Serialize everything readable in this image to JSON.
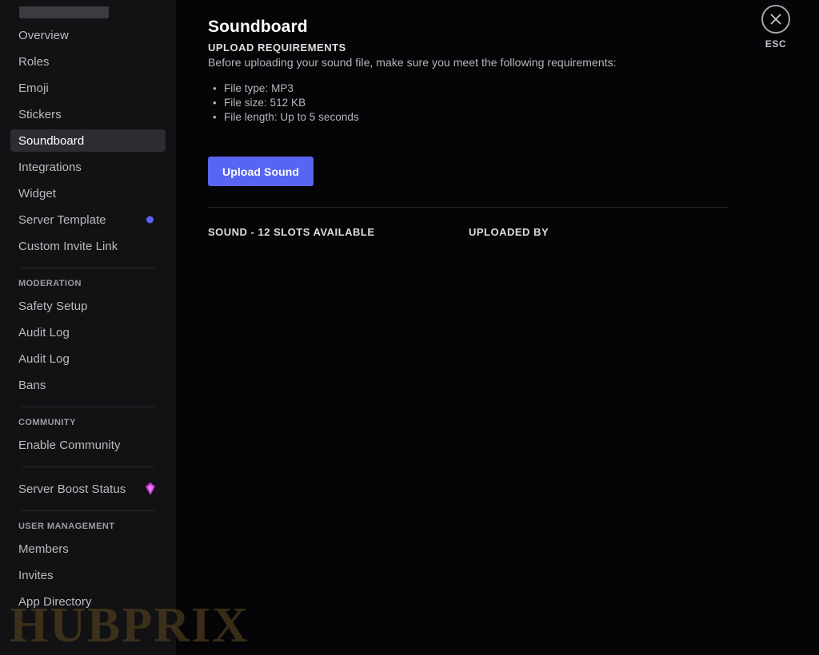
{
  "window": {
    "background_color": "#050507",
    "sidebar_color": "#121214",
    "accent_color": "#5865f2",
    "boost_color": "#ff73fa"
  },
  "sidebar": {
    "skeleton_placeholder": "",
    "groups": [
      {
        "header": null,
        "items": [
          {
            "label": "Overview",
            "selected": false,
            "badge": null
          },
          {
            "label": "Roles",
            "selected": false,
            "badge": null
          },
          {
            "label": "Emoji",
            "selected": false,
            "badge": null
          },
          {
            "label": "Stickers",
            "selected": false,
            "badge": null
          },
          {
            "label": "Soundboard",
            "selected": true,
            "badge": null
          },
          {
            "label": "Integrations",
            "selected": false,
            "badge": null
          },
          {
            "label": "Widget",
            "selected": false,
            "badge": null
          },
          {
            "label": "Server Template",
            "selected": false,
            "badge": "dot"
          },
          {
            "label": "Custom Invite Link",
            "selected": false,
            "badge": null
          }
        ]
      },
      {
        "header": "MODERATION",
        "items": [
          {
            "label": "Safety Setup",
            "selected": false,
            "badge": null
          },
          {
            "label": "Audit Log",
            "selected": false,
            "badge": null
          },
          {
            "label": "Audit Log",
            "selected": false,
            "badge": null
          },
          {
            "label": "Bans",
            "selected": false,
            "badge": null
          }
        ]
      },
      {
        "header": "COMMUNITY",
        "items": [
          {
            "label": "Enable Community",
            "selected": false,
            "badge": null
          }
        ]
      },
      {
        "header": null,
        "items": [
          {
            "label": "Server Boost Status",
            "selected": false,
            "badge": "boost"
          }
        ]
      },
      {
        "header": "USER MANAGEMENT",
        "items": [
          {
            "label": "Members",
            "selected": false,
            "badge": null
          },
          {
            "label": "Invites",
            "selected": false,
            "badge": null
          },
          {
            "label": "App Directory",
            "selected": false,
            "badge": null
          }
        ]
      }
    ]
  },
  "main": {
    "title": "Soundboard",
    "requirements_heading": "UPLOAD REQUIREMENTS",
    "requirements_description": "Before uploading your sound file, make sure you meet the following requirements:",
    "requirements": [
      "File type: MP3",
      "File size: 512 KB",
      "File length: Up to 5 seconds"
    ],
    "upload_button_label": "Upload Sound",
    "table": {
      "col_sound": "SOUND - 12 SLOTS AVAILABLE",
      "col_uploaded_by": "UPLOADED BY",
      "rows": []
    }
  },
  "close": {
    "icon": "close-icon",
    "label": "ESC"
  },
  "watermark": {
    "text": "HUBPRIX"
  }
}
